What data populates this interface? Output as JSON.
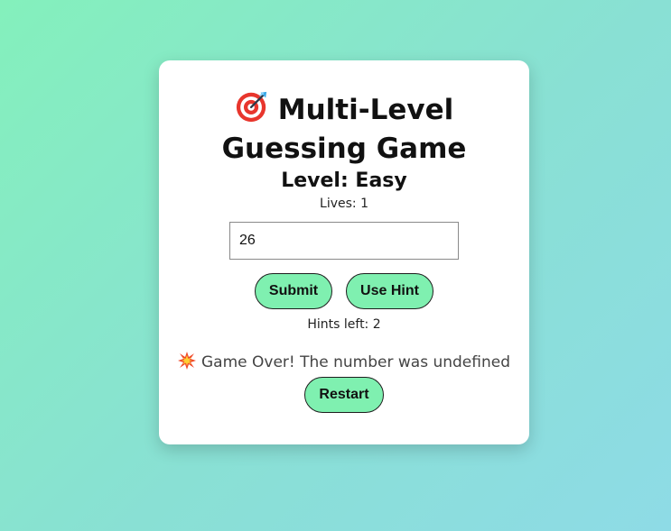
{
  "game": {
    "title": "Multi-Level Guessing Game",
    "title_icon": "direct-hit-target-icon",
    "level_text": "Level: Easy",
    "lives_text": "Lives: 1",
    "guess_value": "26",
    "submit_label": "Submit",
    "hint_label": "Use Hint",
    "hints_left_text": "Hints left: 2",
    "message_icon": "collision-burst-icon",
    "message_text": "Game Over! The number was undefined",
    "restart_label": "Restart"
  },
  "colors": {
    "background_start": "#84f0bc",
    "background_end": "#8edbe6",
    "card": "#ffffff",
    "button_fill": "#7ff0b0",
    "message_text": "#444444"
  }
}
